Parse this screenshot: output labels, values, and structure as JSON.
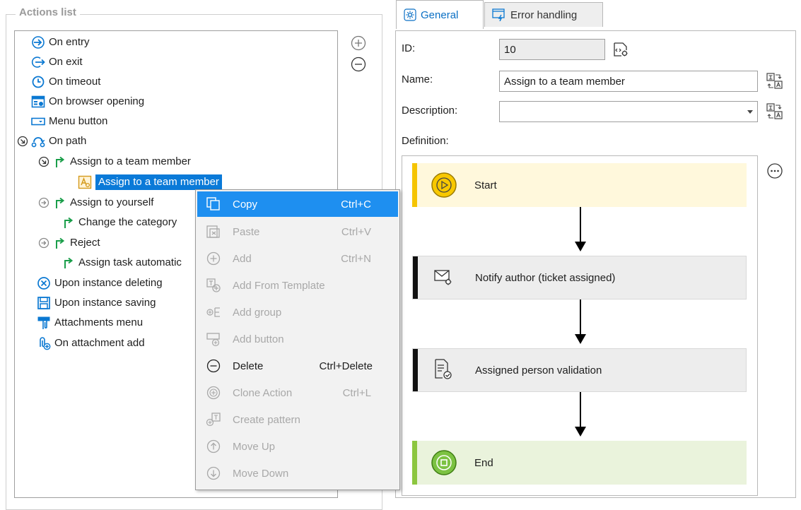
{
  "actions_panel": {
    "title": "Actions list",
    "items": [
      {
        "label": "On entry",
        "icon": "entry-arrow-icon"
      },
      {
        "label": "On exit",
        "icon": "exit-arrow-icon"
      },
      {
        "label": "On timeout",
        "icon": "clock-icon"
      },
      {
        "label": "On browser opening",
        "icon": "browser-icon"
      },
      {
        "label": "Menu button",
        "icon": "menu-button-icon"
      },
      {
        "label": "On path",
        "icon": "path-icon"
      },
      {
        "label": "Assign to a team member",
        "icon": "path-branch-icon"
      },
      {
        "label": "Assign to a team member",
        "icon": "action-icon"
      },
      {
        "label": "Assign to yourself",
        "icon": "path-branch-icon"
      },
      {
        "label": "Change the category",
        "icon": "path-branch-icon"
      },
      {
        "label": "Reject",
        "icon": "path-branch-icon"
      },
      {
        "label": "Assign task automatic",
        "icon": "path-branch-icon"
      },
      {
        "label": "Upon instance deleting",
        "icon": "delete-circle-icon"
      },
      {
        "label": "Upon instance saving",
        "icon": "save-icon"
      },
      {
        "label": "Attachments menu",
        "icon": "attachment-icon"
      },
      {
        "label": "On attachment add",
        "icon": "attachment-add-icon"
      }
    ]
  },
  "context_menu": {
    "items": [
      {
        "label": "Copy",
        "shortcut": "Ctrl+C",
        "icon": "copy-icon",
        "state": "highlighted"
      },
      {
        "label": "Paste",
        "shortcut": "Ctrl+V",
        "icon": "paste-icon",
        "state": "disabled"
      },
      {
        "label": "Add",
        "shortcut": "Ctrl+N",
        "icon": "add-icon",
        "state": "disabled"
      },
      {
        "label": "Add From Template",
        "shortcut": "",
        "icon": "template-icon",
        "state": "disabled"
      },
      {
        "label": "Add group",
        "shortcut": "",
        "icon": "add-group-icon",
        "state": "disabled"
      },
      {
        "label": "Add button",
        "shortcut": "",
        "icon": "add-button-icon",
        "state": "disabled"
      },
      {
        "label": "Delete",
        "shortcut": "Ctrl+Delete",
        "icon": "delete-icon",
        "state": "enabled"
      },
      {
        "label": "Clone Action",
        "shortcut": "Ctrl+L",
        "icon": "clone-icon",
        "state": "disabled"
      },
      {
        "label": "Create pattern",
        "shortcut": "",
        "icon": "pattern-icon",
        "state": "disabled"
      },
      {
        "label": "Move Up",
        "shortcut": "",
        "icon": "move-up-icon",
        "state": "disabled"
      },
      {
        "label": "Move Down",
        "shortcut": "",
        "icon": "move-down-icon",
        "state": "disabled"
      }
    ]
  },
  "tabs": [
    {
      "label": "General",
      "active": true,
      "icon": "gear-icon"
    },
    {
      "label": "Error handling",
      "active": false,
      "icon": "error-handling-icon"
    }
  ],
  "form": {
    "id_label": "ID:",
    "id_value": "10",
    "name_label": "Name:",
    "name_value": "Assign to a team member",
    "description_label": "Description:",
    "description_value": "",
    "definition_label": "Definition:"
  },
  "definition": {
    "steps": [
      {
        "label": "Start",
        "type": "start"
      },
      {
        "label": "Notify author (ticket assigned)",
        "type": "action"
      },
      {
        "label": "Assigned person validation",
        "type": "action"
      },
      {
        "label": "End",
        "type": "end"
      }
    ]
  },
  "colors": {
    "selection": "#0a7ad8",
    "menu_highlight": "#1e8ff0",
    "start_bg": "#fff8dc",
    "start_accent": "#f5c400",
    "end_bg": "#eaf3dc",
    "end_accent": "#8cc63f",
    "action_bg": "#ededed",
    "tab_active_text": "#0a6fc4"
  }
}
